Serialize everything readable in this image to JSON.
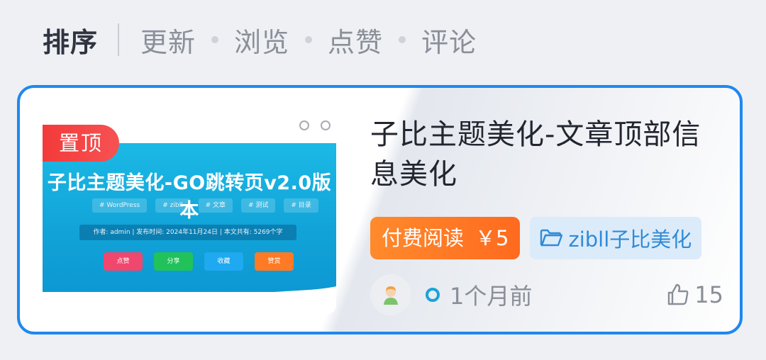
{
  "sort": {
    "label": "排序",
    "options": [
      "更新",
      "浏览",
      "点赞",
      "评论"
    ]
  },
  "post": {
    "title": "子比主题美化-文章顶部信息美化",
    "pin_label": "置顶",
    "thumbnail": {
      "title": "子比主题美化-GO跳转页v2.0版本",
      "tags": [
        "# WordPress",
        "# zibll",
        "# 文章",
        "# 测试",
        "# 目录"
      ],
      "meta": "作者: admin | 发布时间: 2024年11月24日 | 本文共有: 5269个字",
      "buttons": [
        "点赞",
        "分享",
        "收藏",
        "赞赏"
      ]
    },
    "paid": {
      "label": "付费阅读",
      "price": "￥5"
    },
    "category": "zibll子比美化",
    "time": "1个月前",
    "likes": "15"
  },
  "colors": {
    "accent_border": "#1e88f0",
    "pin_red": "#f33a3a",
    "paid_orange": "#ff7a25",
    "category_blue": "#2f8bd8",
    "online_dot": "#1aa3d9"
  },
  "icons": {
    "folder": "folder-icon",
    "like": "thumbs-up-icon",
    "avatar": "user-avatar"
  }
}
